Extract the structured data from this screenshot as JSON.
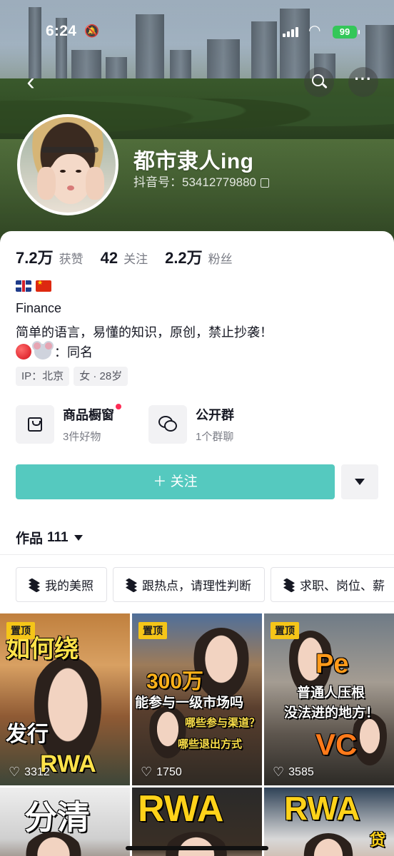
{
  "status_bar": {
    "time": "6:24",
    "battery": "99"
  },
  "profile": {
    "nickname": "都市隶人ing",
    "douyin_id": "抖音号：53412779880"
  },
  "stats": [
    {
      "value": "7.2万",
      "label": "获赞"
    },
    {
      "value": "42",
      "label": "关注"
    },
    {
      "value": "2.2万",
      "label": "粉丝"
    }
  ],
  "bio": {
    "line1": "Finance",
    "line2": "简单的语言，易懂的知识，原创，禁止抄袭！",
    "line3": "：同名"
  },
  "tags": [
    "IP：北京",
    "女 · 28岁"
  ],
  "features": [
    {
      "title": "商品橱窗",
      "subtitle": "3件好物",
      "icon": "shopping-bag-icon",
      "has_dot": true
    },
    {
      "title": "公开群",
      "subtitle": "1个群聊",
      "icon": "group-chat-icon",
      "has_dot": false
    }
  ],
  "follow_button": "＋ 关注",
  "works": {
    "label": "作品",
    "count": "111"
  },
  "collections": [
    "我的美照",
    "跟热点，请理性判断",
    "求职、岗位、薪"
  ],
  "videos": [
    {
      "pinned": "置顶",
      "likes": "3312",
      "overlay": [
        "如何绕",
        "发行",
        "RWA"
      ]
    },
    {
      "pinned": "置顶",
      "likes": "1750",
      "overlay": [
        "300万",
        "能参与一级市场吗",
        "哪些参与渠道？",
        "哪些退出方式"
      ]
    },
    {
      "pinned": "置顶",
      "likes": "3585",
      "overlay": [
        "Pe",
        "普通人压根",
        "没法进的地方！",
        "VC"
      ]
    },
    {
      "overlay": [
        "分清"
      ]
    },
    {
      "overlay": [
        "RWA"
      ]
    },
    {
      "overlay": [
        "RWA",
        "贷"
      ]
    }
  ],
  "colors": {
    "follow_button": "#55c9bf",
    "pin_badge": "#f5c518",
    "notification_dot": "#fe2c55"
  }
}
